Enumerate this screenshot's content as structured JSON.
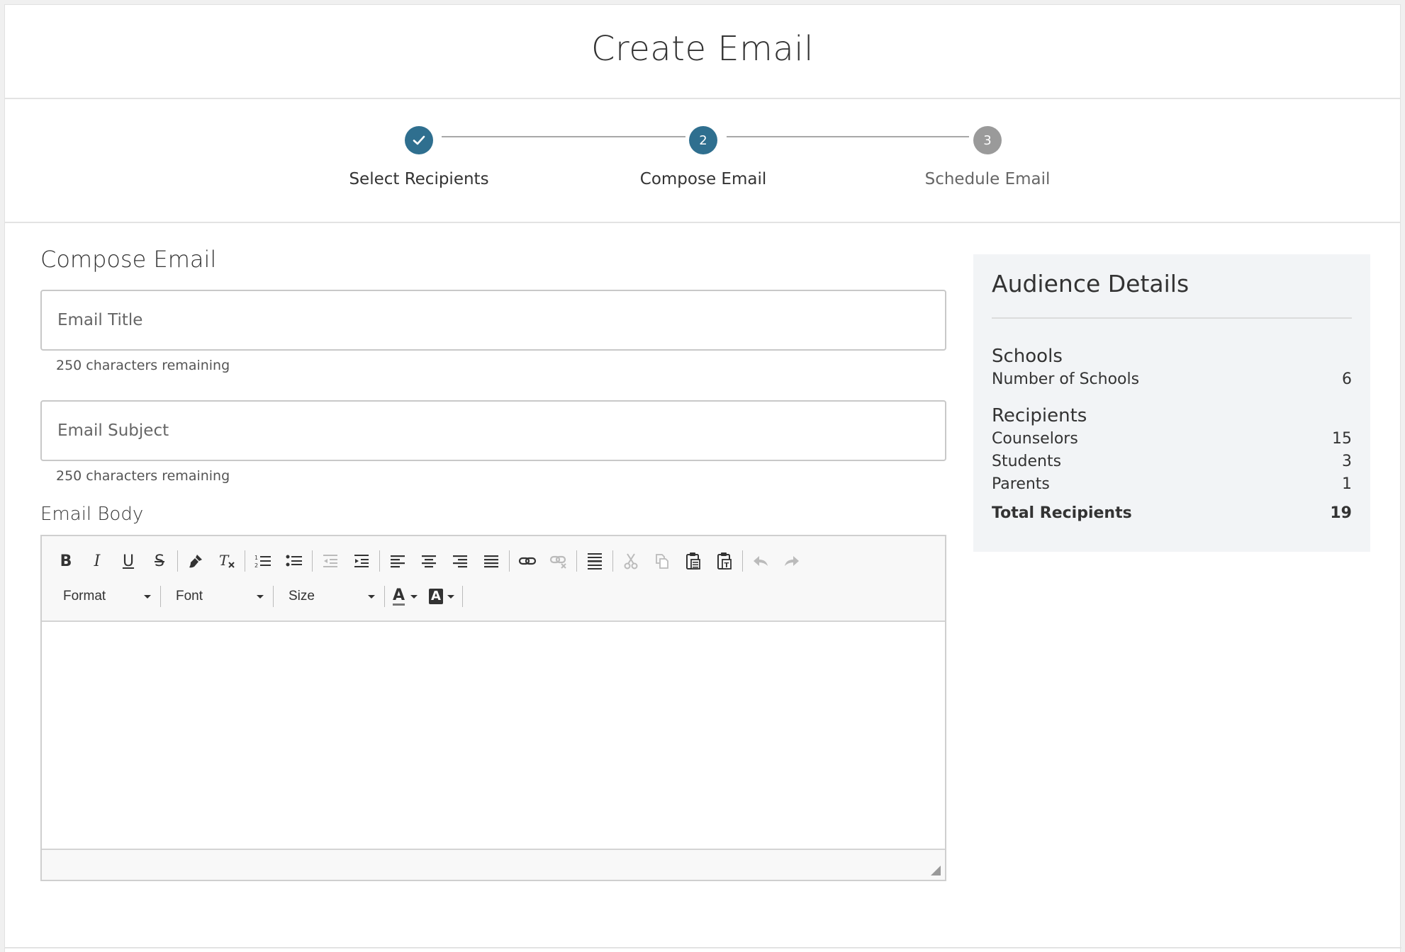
{
  "header": {
    "title": "Create Email"
  },
  "stepper": {
    "steps": [
      {
        "number": "",
        "label": "Select Recipients",
        "state": "done"
      },
      {
        "number": "2",
        "label": "Compose Email",
        "state": "active"
      },
      {
        "number": "3",
        "label": "Schedule Email",
        "state": "pending"
      }
    ]
  },
  "compose": {
    "section_title": "Compose Email",
    "title_field": {
      "placeholder": "Email Title",
      "value": "",
      "helper": "250 characters remaining"
    },
    "subject_field": {
      "placeholder": "Email Subject",
      "value": "",
      "helper": "250 characters remaining"
    },
    "body_label": "Email Body",
    "toolbar": {
      "bold": "B",
      "italic": "I",
      "underline": "U",
      "strike": "S",
      "format_label": "Format",
      "font_label": "Font",
      "size_label": "Size",
      "text_color": "A",
      "bg_color": "A"
    }
  },
  "audience": {
    "title": "Audience Details",
    "schools": {
      "heading": "Schools",
      "rows": [
        {
          "label": "Number of Schools",
          "value": "6"
        }
      ]
    },
    "recipients": {
      "heading": "Recipients",
      "rows": [
        {
          "label": "Counselors",
          "value": "15"
        },
        {
          "label": "Students",
          "value": "3"
        },
        {
          "label": "Parents",
          "value": "1"
        }
      ]
    },
    "total": {
      "label": "Total Recipients",
      "value": "19"
    }
  },
  "colors": {
    "accent": "#2f6f8f",
    "pending": "#9a9a9a"
  }
}
